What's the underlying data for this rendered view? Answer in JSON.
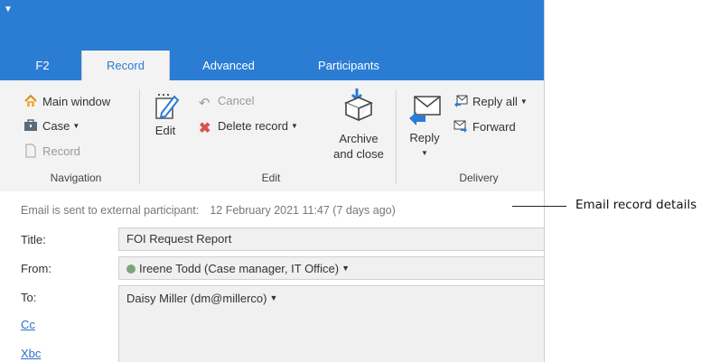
{
  "tabs": [
    {
      "label": "F2"
    },
    {
      "label": "Record"
    },
    {
      "label": "Advanced"
    },
    {
      "label": "Participants"
    }
  ],
  "ribbon": {
    "navigation": {
      "main_window": "Main window",
      "case": "Case",
      "record": "Record",
      "group_label": "Navigation"
    },
    "edit": {
      "edit": "Edit",
      "cancel": "Cancel",
      "delete_record": "Delete record",
      "archive_line1": "Archive",
      "archive_line2": "and close",
      "group_label": "Edit"
    },
    "delivery": {
      "reply": "Reply",
      "reply_all": "Reply all",
      "forward": "Forward",
      "group_label": "Delivery"
    }
  },
  "record": {
    "sent_status": "Email is sent to external participant:",
    "sent_date": "12 February 2021 11:47 (7 days ago)",
    "title_label": "Title:",
    "title_value": "FOI Request Report",
    "from_label": "From:",
    "from_value": "Ireene Todd (Case manager, IT Office)",
    "to_label": "To:",
    "to_value": "Daisy Miller (dm@millerco)",
    "cc_label": "Cc",
    "xbc_label": "Xbc"
  },
  "annotation": "Email record details",
  "colors": {
    "accent": "#2b7cd3",
    "ribbon_bg": "#f3f3f3",
    "delete": "#d9534f"
  }
}
